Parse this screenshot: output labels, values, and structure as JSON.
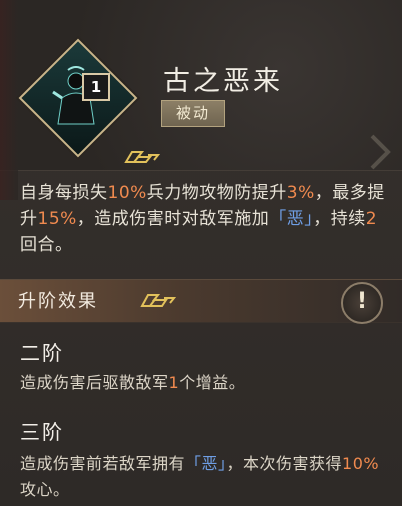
{
  "skill": {
    "level": "1",
    "name": "古之恶来",
    "type": "被动"
  },
  "description": {
    "p1": "自身每损失",
    "n1": "10%",
    "p2": "兵力物攻物防提升",
    "n2": "3%",
    "p3": "，最多提升",
    "n3": "15%",
    "p4": "，造成伤害时对敌军施加",
    "tag": "「恶」",
    "p5": "，持续",
    "n4": "2",
    "p6": "回合。"
  },
  "upgrade": {
    "title": "升阶效果",
    "info": "!"
  },
  "stages": [
    {
      "title": "二阶",
      "p1": "造成伤害后驱散敌军",
      "n1": "1",
      "p2": "个增益。"
    },
    {
      "title": "三阶",
      "p1": "造成伤害前若敌军拥有",
      "tag": "「恶」",
      "p2": "，本次伤害获得",
      "n1": "10%",
      "p3": "攻心。"
    }
  ],
  "colors": {
    "highlight": "#f08a4f",
    "tag": "#6f9fe6",
    "text": "#e7e2d6",
    "frame": "#c9b58a"
  }
}
